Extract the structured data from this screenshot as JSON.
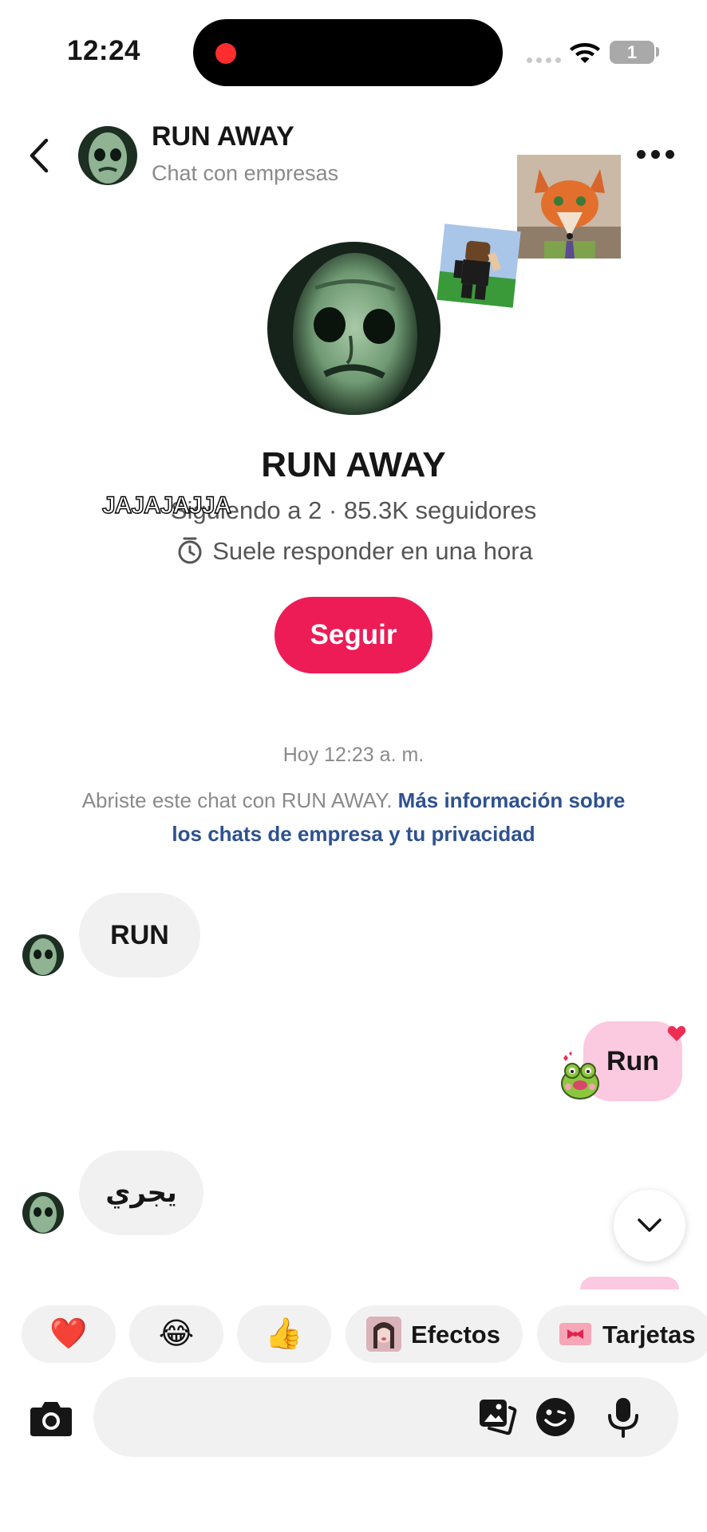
{
  "status_bar": {
    "time": "12:24",
    "battery": "1"
  },
  "header": {
    "name": "RUN AWAY",
    "subtitle": "Chat con empresas"
  },
  "profile": {
    "name": "RUN AWAY",
    "stats": "Siguiendo a 2 · 85.3K seguidores",
    "overlay_caption": "JAJAJAJJA",
    "response": "Suele responder en una hora",
    "follow_label": "Seguir"
  },
  "chat_meta": {
    "date": "Hoy 12:23 a. m.",
    "info_prefix": "Abriste este chat con RUN AWAY. ",
    "info_link": "Más información sobre los chats de empresa y tu privacidad"
  },
  "messages": [
    {
      "direction": "in",
      "text": "RUN"
    },
    {
      "direction": "out",
      "text": "Run"
    },
    {
      "direction": "in",
      "text": "يجري"
    }
  ],
  "quick_chips": [
    {
      "icon": "heart-emoji",
      "emoji": "❤️"
    },
    {
      "icon": "laughing-emoji",
      "emoji": "😂"
    },
    {
      "icon": "thumbs-up-emoji",
      "emoji": "👍"
    },
    {
      "icon": "effects-thumbnail",
      "label": "Efectos"
    },
    {
      "icon": "gift-card-icon",
      "label": "Tarjetas"
    }
  ],
  "input": {
    "placeholder": ""
  },
  "colors": {
    "accent": "#ed1c56",
    "outgoing_bubble": "#fbc9e0",
    "incoming_bubble": "#f1f1f2",
    "link": "#2e5190"
  }
}
